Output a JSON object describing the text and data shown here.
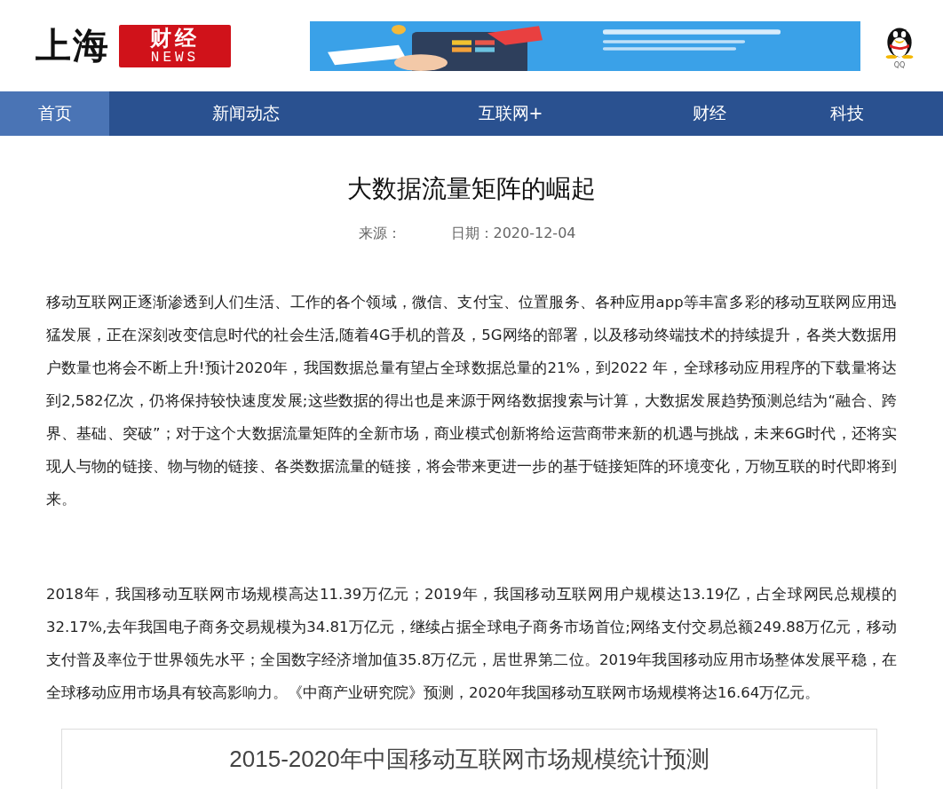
{
  "header": {
    "logo": {
      "city": "上海",
      "brand": "财经",
      "sub": "NEWS"
    },
    "qq_label": "QQ"
  },
  "nav": [
    {
      "label": "首页",
      "selected": true
    },
    {
      "label": "新闻动态",
      "selected": false
    },
    {
      "label": "互联网+",
      "selected": false
    },
    {
      "label": "财经",
      "selected": false
    },
    {
      "label": "科技",
      "selected": false
    }
  ],
  "article": {
    "title": "大数据流量矩阵的崛起",
    "source_label": "来源：",
    "date": "日期：2020-12-04",
    "paragraphs": [
      "移动互联网正逐渐渗透到人们生活、工作的各个领域，微信、支付宝、位置服务、各种应用app等丰富多彩的移动互联网应用迅猛发展，正在深刻改变信息时代的社会生活,随着4G手机的普及，5G网络的部署，以及移动终端技术的持续提升，各类大数据用户数量也将会不断上升!预计2020年，我国数据总量有望占全球数据总量的21%，到2022 年，全球移动应用程序的下载量将达到2,582亿次，仍将保持较快速度发展;这些数据的得出也是来源于网络数据搜索与计算，大数据发展趋势预测总结为“融合、跨界、基础、突破”；对于这个大数据流量矩阵的全新市场，商业模式创新将给运营商带来新的机遇与挑战，未来6G时代，还将实现人与物的链接、物与物的链接、各类数据流量的链接，将会带来更进一步的基于链接矩阵的环境变化，万物互联的时代即将到来。",
      "2018年，我国移动互联网市场规模高达11.39万亿元；2019年，我国移动互联网用户规模达13.19亿，占全球网民总规模的32.17%,去年我国电子商务交易规模为34.81万亿元，继续占据全球电子商务市场首位;网络支付交易总额249.88万亿元，移动支付普及率位于世界领先水平；全国数字经济增加值35.8万亿元，居世界第二位。2019年我国移动应用市场整体发展平稳，在全球移动应用市场具有较高影响力。《中商产业研究院》预测，2020年我国移动互联网市场规模将达16.64万亿元。"
    ],
    "figure_title": "2015-2020年中国移动互联网市场规模统计预测"
  }
}
